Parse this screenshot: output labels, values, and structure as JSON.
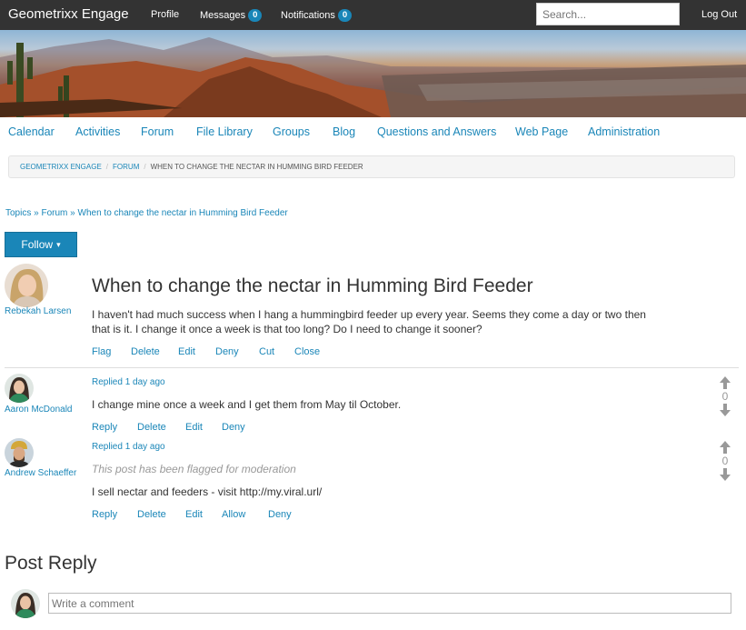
{
  "topbar": {
    "brand": "Geometrixx Engage",
    "profile": "Profile",
    "messages": "Messages",
    "messages_count": "0",
    "notifications": "Notifications",
    "notifications_count": "0",
    "search_placeholder": "Search...",
    "logout": "Log Out"
  },
  "nav": [
    "Calendar",
    "Activities",
    "Forum",
    "File Library",
    "Groups",
    "Blog",
    "Questions and Answers",
    "Web Page",
    "Administration"
  ],
  "breadcrumb": [
    "GEOMETRIXX ENGAGE",
    "FORUM",
    "WHEN TO CHANGE THE NECTAR IN HUMMING BIRD FEEDER"
  ],
  "breadcrumb_sep": "/",
  "topics": {
    "topics": "Topics",
    "sep": "»",
    "forum": "Forum",
    "current": "When to change the nectar in Humming Bird Feeder"
  },
  "follow": {
    "label": "Follow",
    "caret": "▾"
  },
  "post": {
    "author": "Rebekah Larsen",
    "title": "When to change the nectar in Humming Bird Feeder",
    "body": "I haven't had much success when I hang a hummingbird feeder up every year. Seems they come a day or two then that is it. I change it once a week is that too long? Do I need to change it sooner?",
    "actions": [
      "Flag",
      "Delete",
      "Edit",
      "Deny",
      "Cut",
      "Close"
    ]
  },
  "replies": [
    {
      "author": "Aaron McDonald",
      "meta": "Replied 1 day ago",
      "text": "I change mine once a week and I get them from May til October.",
      "actions": [
        "Reply",
        "Delete",
        "Edit",
        "Deny"
      ],
      "votes": "0"
    },
    {
      "author": "Andrew Schaeffer",
      "meta": "Replied 1 day ago",
      "flag_note": "This post has been flagged for moderation",
      "text": "I sell nectar and feeders - visit http://my.viral.url/",
      "actions": [
        "Reply",
        "Delete",
        "Edit",
        "Allow",
        "Deny"
      ],
      "votes": "0"
    }
  ],
  "post_reply": {
    "heading": "Post Reply",
    "placeholder": "Write a comment"
  },
  "colors": {
    "accent": "#1a86b8",
    "topbar": "#333333"
  }
}
